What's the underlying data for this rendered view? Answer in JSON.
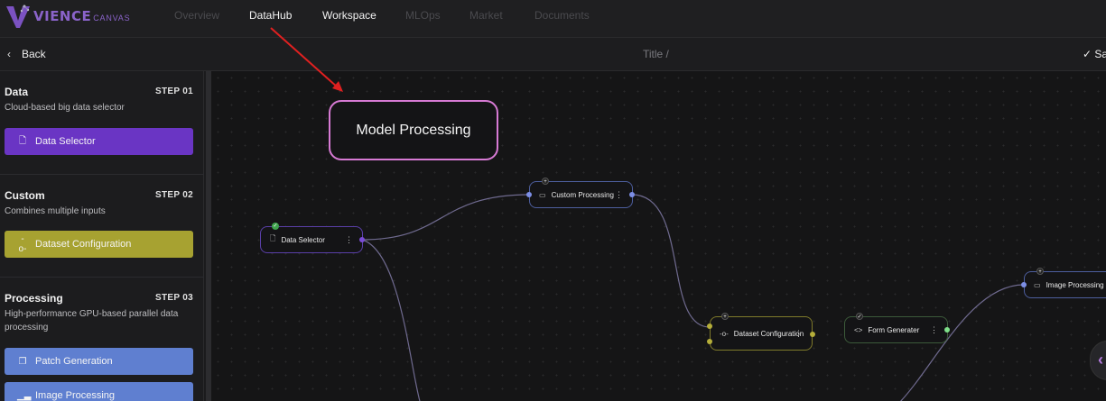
{
  "brand": {
    "name": "VIENCE",
    "sub": "CANVAS",
    "accent": "#8a63c9"
  },
  "nav": {
    "items": [
      {
        "label": "Overview",
        "active": false
      },
      {
        "label": "DataHub",
        "active": true
      },
      {
        "label": "Workspace",
        "active": true
      },
      {
        "label": "MLOps",
        "active": false
      },
      {
        "label": "Market",
        "active": false
      },
      {
        "label": "Documents",
        "active": false
      }
    ]
  },
  "subbar": {
    "back_label": "Back",
    "title": "Title /",
    "save_label": "Sa"
  },
  "sidebar": {
    "steps": [
      {
        "name": "Data",
        "num": "STEP 01",
        "desc": "Cloud-based big data selector",
        "buttons": [
          {
            "label": "Data Selector",
            "icon": "file-icon",
            "color": "#6a35c4"
          }
        ]
      },
      {
        "name": "Custom",
        "num": "STEP 02",
        "desc": "Combines multiple inputs",
        "buttons": [
          {
            "label": "Dataset Configuration",
            "icon": "node-link-icon",
            "color": "#a7a231"
          }
        ]
      },
      {
        "name": "Processing",
        "num": "STEP 03",
        "desc": "High-performance GPU-based parallel data processing",
        "buttons": [
          {
            "label": "Patch Generation",
            "icon": "copy-icon",
            "color": "#5f7fd0"
          },
          {
            "label": "Image Processing",
            "icon": "bar-chart-icon",
            "color": "#5f7fd0"
          }
        ]
      }
    ]
  },
  "canvas": {
    "nodes": [
      {
        "id": "data-selector",
        "label": "Data Selector",
        "icon": "file-icon",
        "border": "#5a3fa8",
        "port": "#7b4cd6"
      },
      {
        "id": "custom-processing",
        "label": "Custom Processing",
        "icon": "window-icon",
        "border": "#4d5e9e",
        "port": "#7d8fe6"
      },
      {
        "id": "dataset-configuration",
        "label": "Dataset Configuration",
        "icon": "node-link-icon",
        "border": "#7f7a2a",
        "port": "#b5ae3a"
      },
      {
        "id": "form-generater",
        "label": "Form Generater",
        "icon": "code-icon",
        "border": "#3c5a3a",
        "port": "#7fe08a"
      },
      {
        "id": "image-processing",
        "label": "Image Processing",
        "icon": "window-icon",
        "border": "#4d5e9e",
        "port": "#7d8fe6"
      }
    ],
    "callout": "Model Processing"
  }
}
